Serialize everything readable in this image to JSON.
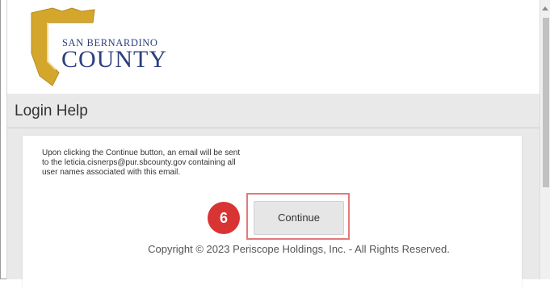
{
  "logo": {
    "line1": "SAN BERNARDINO",
    "line2": "COUNTY",
    "colors": {
      "shield": "#d4a72c",
      "text": "#2c3e7f"
    }
  },
  "page": {
    "title": "Login Help"
  },
  "message": {
    "line1": "Upon clicking the Continue button, an email will be sent",
    "line2": "to the leticia.cisnerps@pur.sbcounty.gov containing all",
    "line3": "user names associated with this email."
  },
  "actions": {
    "continue_label": "Continue"
  },
  "annotation": {
    "step_number": "6",
    "color": "#d93434"
  },
  "footer": {
    "copyright": "Copyright © 2023 Periscope Holdings, Inc. - All Rights Reserved."
  }
}
